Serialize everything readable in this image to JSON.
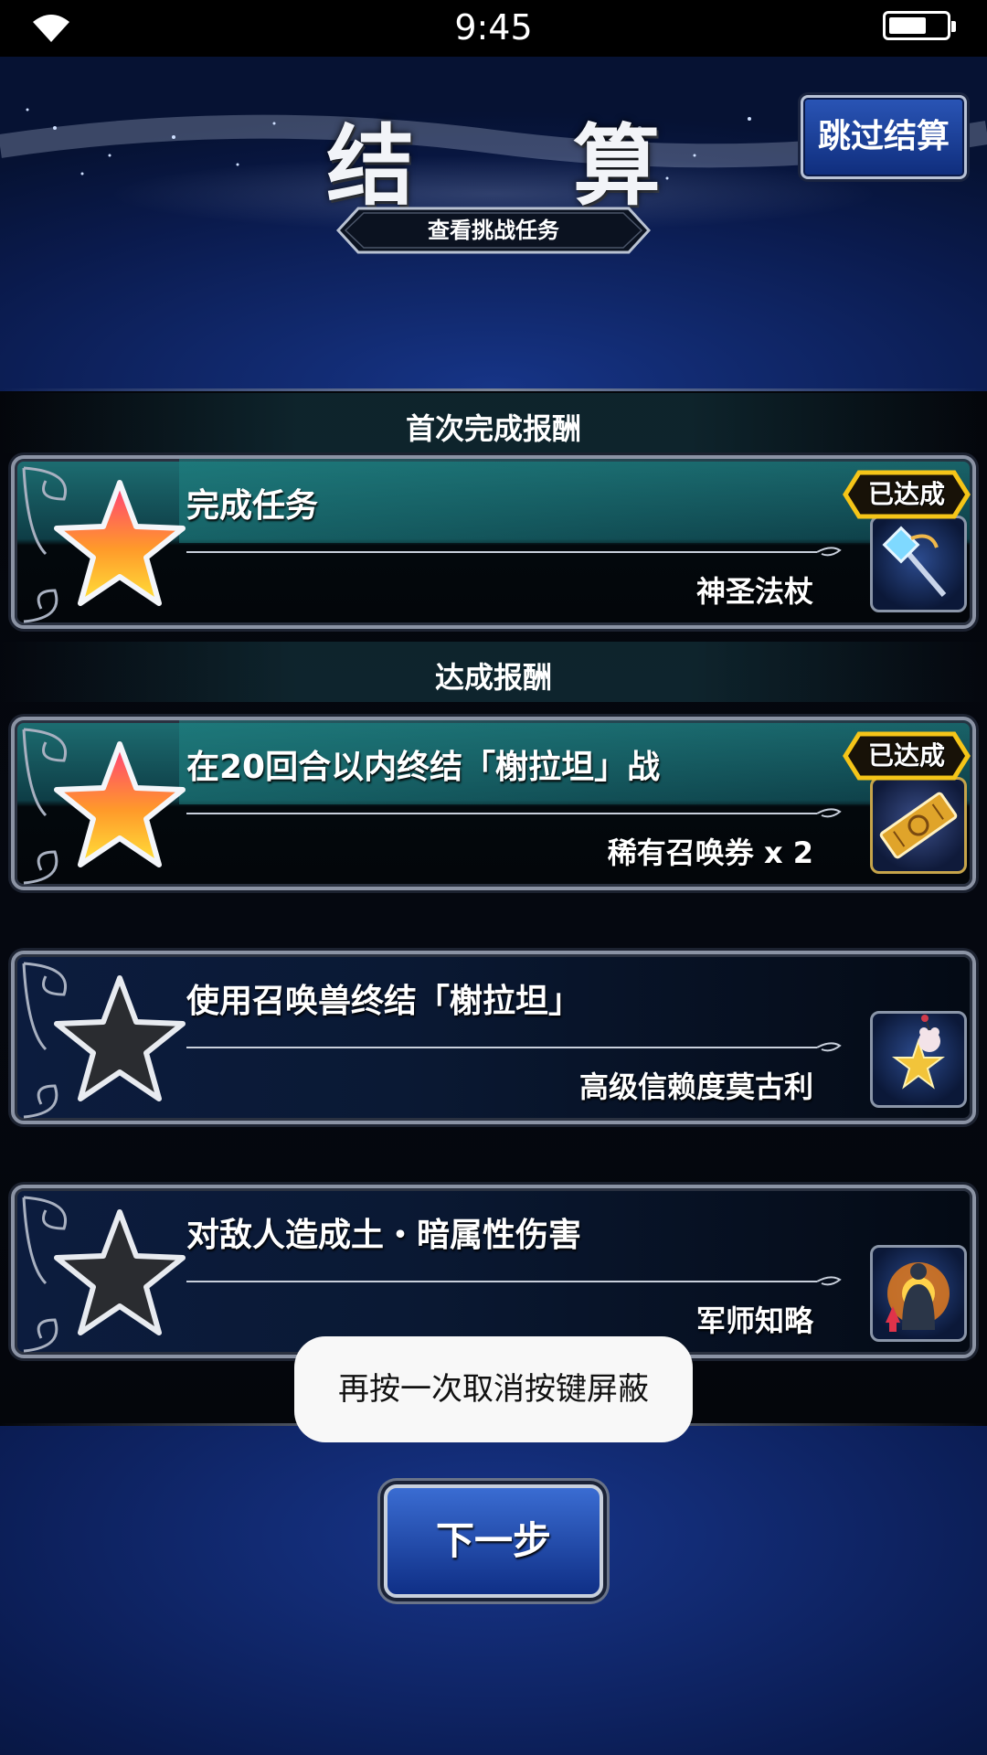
{
  "status_bar": {
    "time": "9:45",
    "wifi_icon": "wifi-icon",
    "battery_icon": "battery-icon"
  },
  "header": {
    "title": "结 算",
    "skip_label": "跳过结算",
    "challenge_label": "查看挑战任务"
  },
  "sections": {
    "first_clear": "首次完成报酬",
    "achievement": "达成报酬"
  },
  "missions": [
    {
      "title": "完成任务",
      "reward": "神圣法杖",
      "achieved": true,
      "badge": "已达成",
      "reward_icon": "staff-icon"
    },
    {
      "title": "在20回合以内终结「榭拉坦」战",
      "reward": "稀有召唤券 x 2",
      "achieved": true,
      "badge": "已达成",
      "reward_icon": "ticket-icon"
    },
    {
      "title": "使用召唤兽终结「榭拉坦」",
      "reward": "高级信赖度莫古利",
      "achieved": false,
      "reward_icon": "moogle-star-icon"
    },
    {
      "title": "对敌人造成土・暗属性伤害",
      "reward": "军师知略",
      "achieved": false,
      "reward_icon": "strategist-icon"
    }
  ],
  "toast": "再按一次取消按键屏蔽",
  "footer": {
    "next_label": "下一步"
  },
  "colors": {
    "accent_gold": "#f5c518",
    "panel_teal": "#1d6e72",
    "bg_blue": "#0a1a4c"
  }
}
